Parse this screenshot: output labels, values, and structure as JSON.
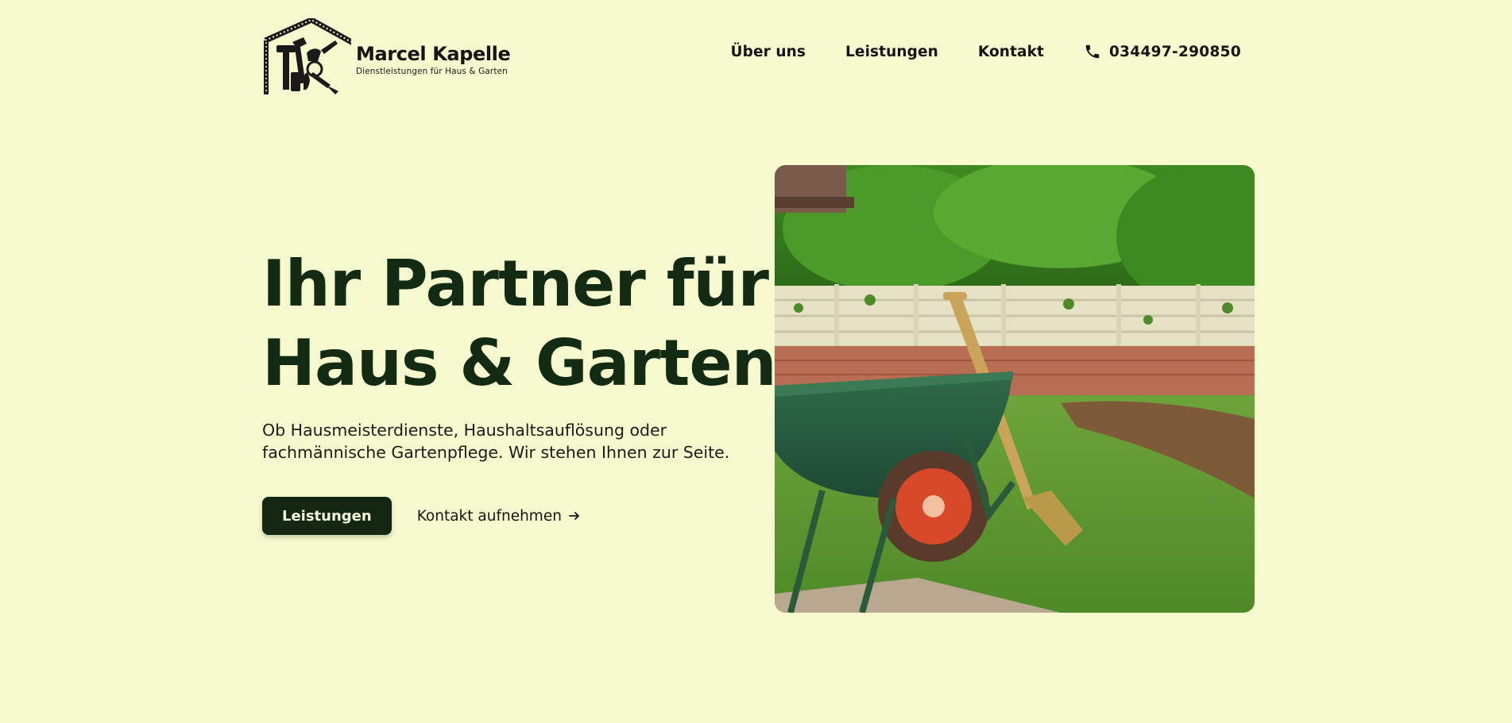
{
  "brand": {
    "name": "Marcel Kapelle",
    "tagline": "Dienstleistungen für Haus & Garten",
    "logo_icon": "house-tools-logo-icon"
  },
  "nav": {
    "items": [
      {
        "label": "Über uns"
      },
      {
        "label": "Leistungen"
      },
      {
        "label": "Kontakt"
      }
    ],
    "phone": {
      "icon": "phone-icon",
      "number": "034497-290850"
    }
  },
  "hero": {
    "title_line1": "Ihr Partner für",
    "title_line2": "Haus & Garten",
    "subtitle": "Ob Hausmeisterdienste, Haushaltsauflösung oder fachmännische Gartenpflege. Wir stehen Ihnen zur Seite.",
    "primary_button": "Leistungen",
    "secondary_link": "Kontakt aufnehmen",
    "secondary_icon": "arrow-right-icon",
    "image": "wheelbarrow-garden-photo"
  },
  "colors": {
    "background": "#f6f9cd",
    "primary": "#132713",
    "text": "#151515"
  }
}
